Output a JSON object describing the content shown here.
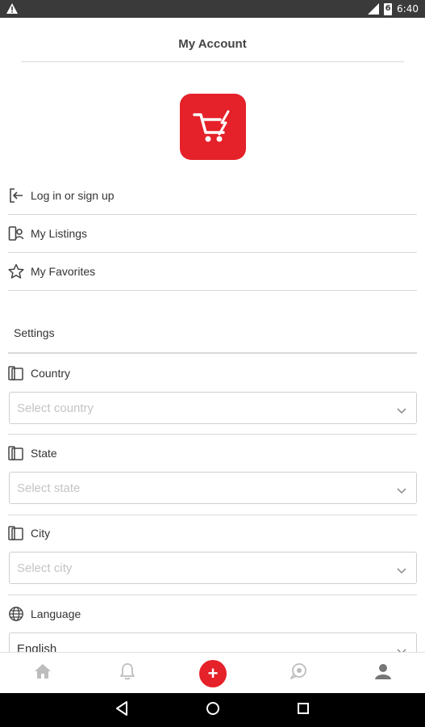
{
  "status_bar": {
    "time": "6:40",
    "battery": "6"
  },
  "header": {
    "title": "My Account"
  },
  "menu": {
    "items": [
      {
        "label": "Log in or sign up"
      },
      {
        "label": "My Listings"
      },
      {
        "label": "My Favorites"
      }
    ]
  },
  "settings": {
    "title": "Settings",
    "country": {
      "label": "Country",
      "placeholder": "Select country"
    },
    "state": {
      "label": "State",
      "placeholder": "Select state"
    },
    "city": {
      "label": "City",
      "placeholder": "Select city"
    },
    "language": {
      "label": "Language",
      "value": "English"
    }
  },
  "tab_bar": {
    "items": [
      "home-icon",
      "bell-icon",
      "add-icon",
      "chat-icon",
      "profile-icon"
    ],
    "add_symbol": "+"
  },
  "colors": {
    "accent": "#e52129",
    "divider": "#d9d9d9",
    "icon_gray": "#9a9a9a"
  }
}
